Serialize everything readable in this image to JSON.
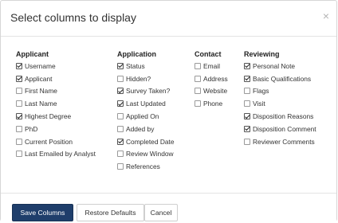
{
  "dialog": {
    "title": "Select columns to display",
    "close_glyph": "×"
  },
  "groups": [
    {
      "heading": "Applicant",
      "options": [
        {
          "label": "Username",
          "checked": true
        },
        {
          "label": "Applicant",
          "checked": true
        },
        {
          "label": "First Name",
          "checked": false
        },
        {
          "label": "Last Name",
          "checked": false
        },
        {
          "label": "Highest Degree",
          "checked": true
        },
        {
          "label": "PhD",
          "checked": false
        },
        {
          "label": "Current Position",
          "checked": false
        },
        {
          "label": "Last Emailed by Analyst",
          "checked": false
        }
      ]
    },
    {
      "heading": "Application",
      "options": [
        {
          "label": "Status",
          "checked": true
        },
        {
          "label": "Hidden?",
          "checked": false
        },
        {
          "label": "Survey Taken?",
          "checked": true
        },
        {
          "label": "Last Updated",
          "checked": true
        },
        {
          "label": "Applied On",
          "checked": false
        },
        {
          "label": "Added by",
          "checked": false
        },
        {
          "label": "Completed Date",
          "checked": true
        },
        {
          "label": "Review Window",
          "checked": false
        },
        {
          "label": "References",
          "checked": false
        }
      ]
    },
    {
      "heading": "Contact",
      "options": [
        {
          "label": "Email",
          "checked": false
        },
        {
          "label": "Address",
          "checked": false
        },
        {
          "label": "Website",
          "checked": false
        },
        {
          "label": "Phone",
          "checked": false
        }
      ]
    },
    {
      "heading": "Reviewing",
      "options": [
        {
          "label": "Personal Note",
          "checked": true
        },
        {
          "label": "Basic Qualifications",
          "checked": true
        },
        {
          "label": "Flags",
          "checked": false
        },
        {
          "label": "Visit",
          "checked": false
        },
        {
          "label": "Disposition Reasons",
          "checked": true
        },
        {
          "label": "Disposition Comment",
          "checked": true
        },
        {
          "label": "Reviewer Comments",
          "checked": false
        }
      ]
    }
  ],
  "footer": {
    "save_label": "Save Columns",
    "restore_label": "Restore Defaults",
    "cancel_label": "Cancel"
  },
  "colors": {
    "primary_button": "#1f3e6b",
    "border": "#d6d6d6"
  }
}
